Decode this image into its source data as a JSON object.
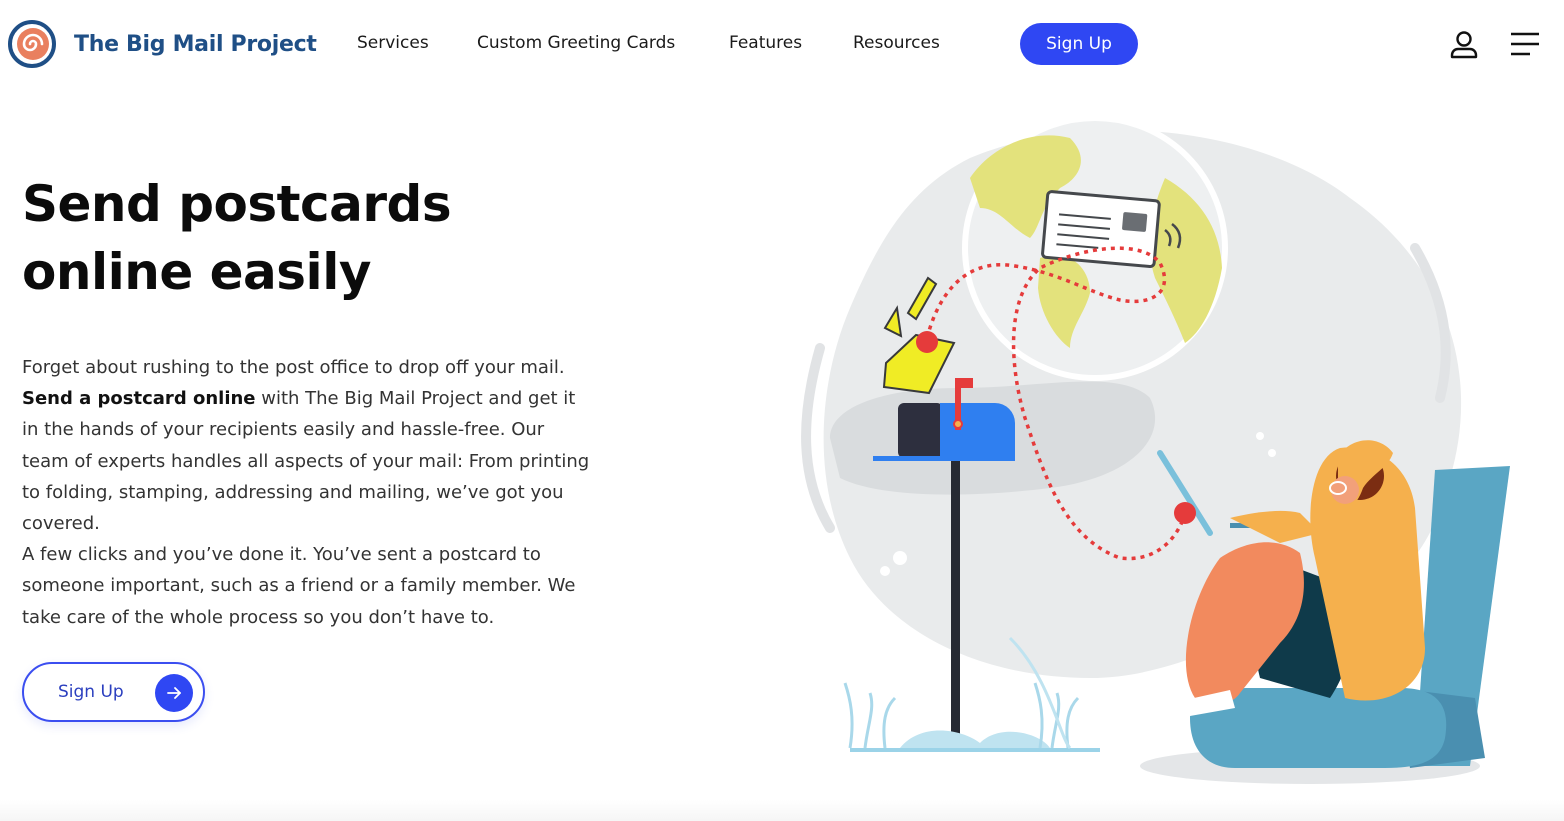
{
  "brand": {
    "name": "The Big Mail Project"
  },
  "nav": {
    "items": [
      {
        "label": "Services"
      },
      {
        "label": "Custom Greeting Cards"
      },
      {
        "label": "Features"
      },
      {
        "label": "Resources"
      }
    ],
    "signup_label": "Sign Up",
    "user_icon": "user-icon",
    "menu_icon": "hamburger-menu-icon"
  },
  "hero": {
    "title_line1": "Send postcards",
    "title_line2": "online easily",
    "para1_start": "Forget about rushing to the post office to drop off your mail. ",
    "para1_bold": "Send a postcard online",
    "para1_end": " with The Big Mail Project and get it in the hands of your recipients easily and hassle-free. Our team of experts handles all aspects of your mail: From printing to folding, stamping, addressing and mailing, we’ve got you covered.",
    "para2": "A few clicks and you’ve done it. You’ve sent a postcard to someone important, such as a friend or a family member. We take care of the whole process so you don’t have to.",
    "cta_label": "Sign Up",
    "cta_icon": "arrow-right-icon"
  },
  "colors": {
    "accent": "#2f47f3",
    "brand_text": "#1f4f86",
    "logo_orange": "#e9805f",
    "globe_land": "#e3e27c",
    "mailbox_blue": "#2f7ff0",
    "hoodie": "#f5b04d",
    "chair": "#5aa6c4",
    "path_red": "#e53b3b"
  }
}
